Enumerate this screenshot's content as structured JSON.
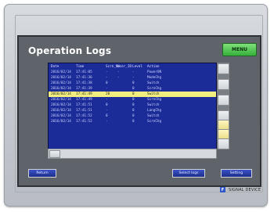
{
  "screen": {
    "title": "Operation Logs",
    "menu_button": "MENU"
  },
  "table": {
    "headers": {
      "date": "Date",
      "time": "Time",
      "scrn": "Scrn_No",
      "user": "User_ID",
      "level": "Level",
      "action": "Action"
    },
    "rows": [
      {
        "date": "2016/02/14",
        "time": "17:41:05",
        "scrn": "-",
        "user": "-",
        "level": "-",
        "action": "PowerON"
      },
      {
        "date": "2016/02/14",
        "time": "17:41:36",
        "scrn": "-",
        "user": "-",
        "level": "-",
        "action": "ModeChg"
      },
      {
        "date": "2016/02/14",
        "time": "17:41:38",
        "scrn": "0",
        "user": "",
        "level": "0",
        "action": "Switch"
      },
      {
        "date": "2016/02/14",
        "time": "17:41:39",
        "scrn": "-",
        "user": "",
        "level": "0",
        "action": "ScrnChg"
      },
      {
        "date": "2016/02/14",
        "time": "17:41:49",
        "scrn": "20",
        "user": "",
        "level": "0",
        "action": "Switch"
      },
      {
        "date": "2016/02/14",
        "time": "17:41:49",
        "scrn": "-",
        "user": "",
        "level": "0",
        "action": "ScrnChg"
      },
      {
        "date": "2016/02/14",
        "time": "17:41:51",
        "scrn": "0",
        "user": "",
        "level": "0",
        "action": "Switch"
      },
      {
        "date": "2016/02/14",
        "time": "17:41:51",
        "scrn": "-",
        "user": "",
        "level": "0",
        "action": "LangChg"
      },
      {
        "date": "2016/02/14",
        "time": "17:41:52",
        "scrn": "0",
        "user": "",
        "level": "0",
        "action": "Switch"
      },
      {
        "date": "2016/02/14",
        "time": "17:41:52",
        "scrn": "-",
        "user": "",
        "level": "0",
        "action": "ScrnChg"
      }
    ]
  },
  "buttons": {
    "return": "Return",
    "select_logs": "Select logs",
    "setting": "Setting"
  },
  "brand": {
    "logo_letter": "F",
    "text": "SIGNAL DEVICE"
  },
  "colors": {
    "table_bg": "#1b2b98",
    "selected_row": "#f1ed7e",
    "menu_green": "#36b03a",
    "button_blue": "#1d2f8a"
  }
}
